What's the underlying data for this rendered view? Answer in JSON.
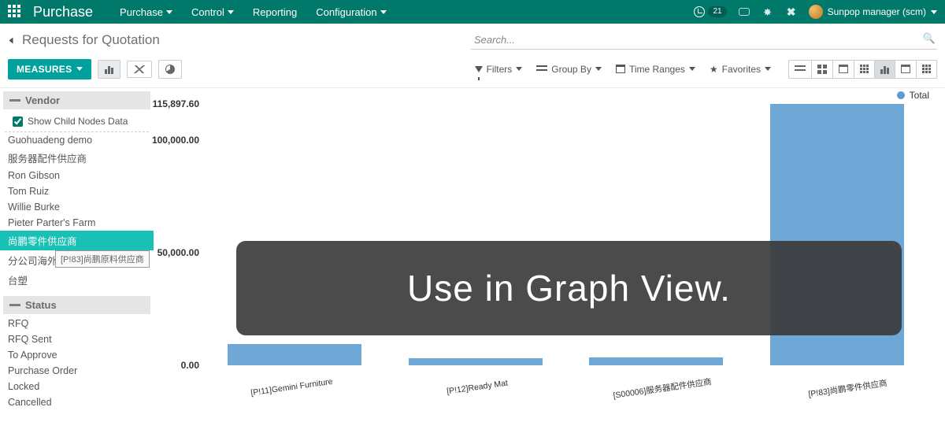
{
  "nav": {
    "app_title": "Purchase",
    "menus": [
      "Purchase",
      "Control",
      "Reporting",
      "Configuration"
    ],
    "menu_has_caret": [
      true,
      true,
      false,
      true
    ],
    "clock_badge": "21",
    "user_name": "Sunpop manager (scm)"
  },
  "breadcrumb": {
    "title": "Requests for Quotation"
  },
  "search": {
    "placeholder": "Search..."
  },
  "controls": {
    "measures_label": "MEASURES",
    "filters_label": "Filters",
    "groupby_label": "Group By",
    "timeranges_label": "Time Ranges",
    "favorites_label": "Favorites"
  },
  "sidebar": {
    "group1_title": "Vendor",
    "checkbox_label": "Show Child Nodes Data",
    "checkbox_checked": true,
    "vendors": [
      "Guohuadeng demo",
      "服务器配件供应商",
      "Ron Gibson",
      "Tom Ruiz",
      "Willie Burke",
      "Pieter Parter's Farm",
      "尚鹏零件供应商",
      "分公司海外",
      "台塑"
    ],
    "vendor_selected_index": 6,
    "vendor_tooltip_index": 7,
    "vendor_tooltip_text": "[P!83]尚鹏原料供应商",
    "group2_title": "Status",
    "statuses": [
      "RFQ",
      "RFQ Sent",
      "To Approve",
      "Purchase Order",
      "Locked",
      "Cancelled"
    ]
  },
  "chart_data": {
    "type": "bar",
    "legend": "Total",
    "yticks": [
      {
        "value": 115897.6,
        "label": "115,897.60"
      },
      {
        "value": 100000.0,
        "label": "100,000.00"
      },
      {
        "value": 50000.0,
        "label": "50,000.00"
      },
      {
        "value": 0.0,
        "label": "0.00"
      }
    ],
    "ylim": [
      0,
      115897.6
    ],
    "categories": [
      "[P!11]Gemini Furniture",
      "[P!12]Ready Mat",
      "[S00006]服务器配件供应商",
      "[P!83]尚鹏零件供应商"
    ],
    "values": [
      9500,
      3200,
      3600,
      115897.6
    ]
  },
  "overlay_text": "Use in Graph View."
}
